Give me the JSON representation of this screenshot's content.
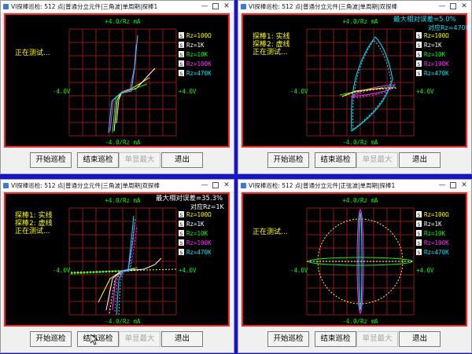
{
  "windows": [
    {
      "title": "VI探棒巡检: 512 点|普通分立元件|三角波|单周期|探棒1",
      "top_label": "+4.0/Rz mA",
      "bottom_label": "-4.0/Rz mA",
      "left_label": "-4.0V",
      "right_label": "+4.0V",
      "status_lines": [
        "正在测试..."
      ],
      "error_line": "",
      "error_sub": "",
      "legend": [
        {
          "label": "Rz=100Ω",
          "color": "#ffff00"
        },
        {
          "label": "Rz=1K",
          "color": "#ffffff"
        },
        {
          "label": "Rz=10K",
          "color": "#00ff00"
        },
        {
          "label": "Rz=100K",
          "color": "#ff33ff"
        },
        {
          "label": "Rz=470K",
          "color": "#00e5ff"
        }
      ],
      "buttons": {
        "start": "开始巡检",
        "end": "结束巡检",
        "max": "单显最大",
        "exit": "退出"
      }
    },
    {
      "title": "VI探棒巡检: 512 点|普通分立元件|三角波|单周期|双探棒",
      "top_label": "+4.0/Rz mA",
      "bottom_label": "-4.0/Rz mA",
      "left_label": "-4.0V",
      "right_label": "+4.0V",
      "status_lines": [
        "探棒1: 实线",
        "探棒2: 虚线",
        "正在测试..."
      ],
      "error_line": "最大相对误差=5.0%",
      "error_sub": "对应Rz=470K",
      "legend": [
        {
          "label": "Rz=100Ω",
          "color": "#ffff00"
        },
        {
          "label": "Rz=1K",
          "color": "#ffffff"
        },
        {
          "label": "Rz=10K",
          "color": "#00ff00"
        },
        {
          "label": "Rz=100K",
          "color": "#ff33ff"
        },
        {
          "label": "Rz=470K",
          "color": "#00e5ff"
        }
      ],
      "buttons": {
        "start": "开始巡检",
        "end": "结束巡检",
        "max": "单显最大",
        "exit": "退出"
      }
    },
    {
      "title": "VI探棒巡检: 512 点|普通分立元件|三角波|单周期|双探棒",
      "top_label": "+4.0/Rz mA",
      "bottom_label": "-4.0/Rz mA",
      "left_label": "-4.0V",
      "right_label": "+4.0V",
      "status_lines": [
        "探棒1: 实线",
        "探棒2: 虚线",
        "正在测试..."
      ],
      "error_line": "最大相对误差=35.3%",
      "error_sub": "对应Rz=1K",
      "legend": [
        {
          "label": "Rz=100Ω",
          "color": "#ffff00"
        },
        {
          "label": "Rz=1K",
          "color": "#ffffff"
        },
        {
          "label": "Rz=10K",
          "color": "#00ff00"
        },
        {
          "label": "Rz=100K",
          "color": "#ff33ff"
        },
        {
          "label": "Rz=470K",
          "color": "#00e5ff"
        }
      ],
      "buttons": {
        "start": "开始巡检",
        "end": "结束巡检",
        "max": "单显最大",
        "exit": "退出"
      }
    },
    {
      "title": "VI探棒巡检: 512 点|普通分立元件|正弦波|单周期|探棒1",
      "top_label": "+4.0/Rz mA",
      "bottom_label": "-4.0/Rz mA",
      "left_label": "-4.0V",
      "right_label": "+4.0V",
      "status_lines": [
        "正在测试..."
      ],
      "error_line": "",
      "error_sub": "",
      "legend": [
        {
          "label": "Rz=100Ω",
          "color": "#ffff00"
        },
        {
          "label": "Rz=1K",
          "color": "#ffffff"
        },
        {
          "label": "Rz=10K",
          "color": "#00ff00"
        },
        {
          "label": "Rz=100K",
          "color": "#ff33ff"
        },
        {
          "label": "Rz=470K",
          "color": "#00e5ff"
        }
      ],
      "buttons": {
        "start": "开始巡检",
        "end": "结束巡检",
        "max": "单显最大",
        "exit": "退出"
      }
    }
  ],
  "legend_marker": "S",
  "colors": {
    "desktop": "#1515c9",
    "frame": "#ff2020",
    "grid": "#8b1a1a",
    "label_green": "#00ff00",
    "status_yellow": "#ffff00",
    "error_white": "#ffffff",
    "error_cyan": "#00e5ff"
  }
}
